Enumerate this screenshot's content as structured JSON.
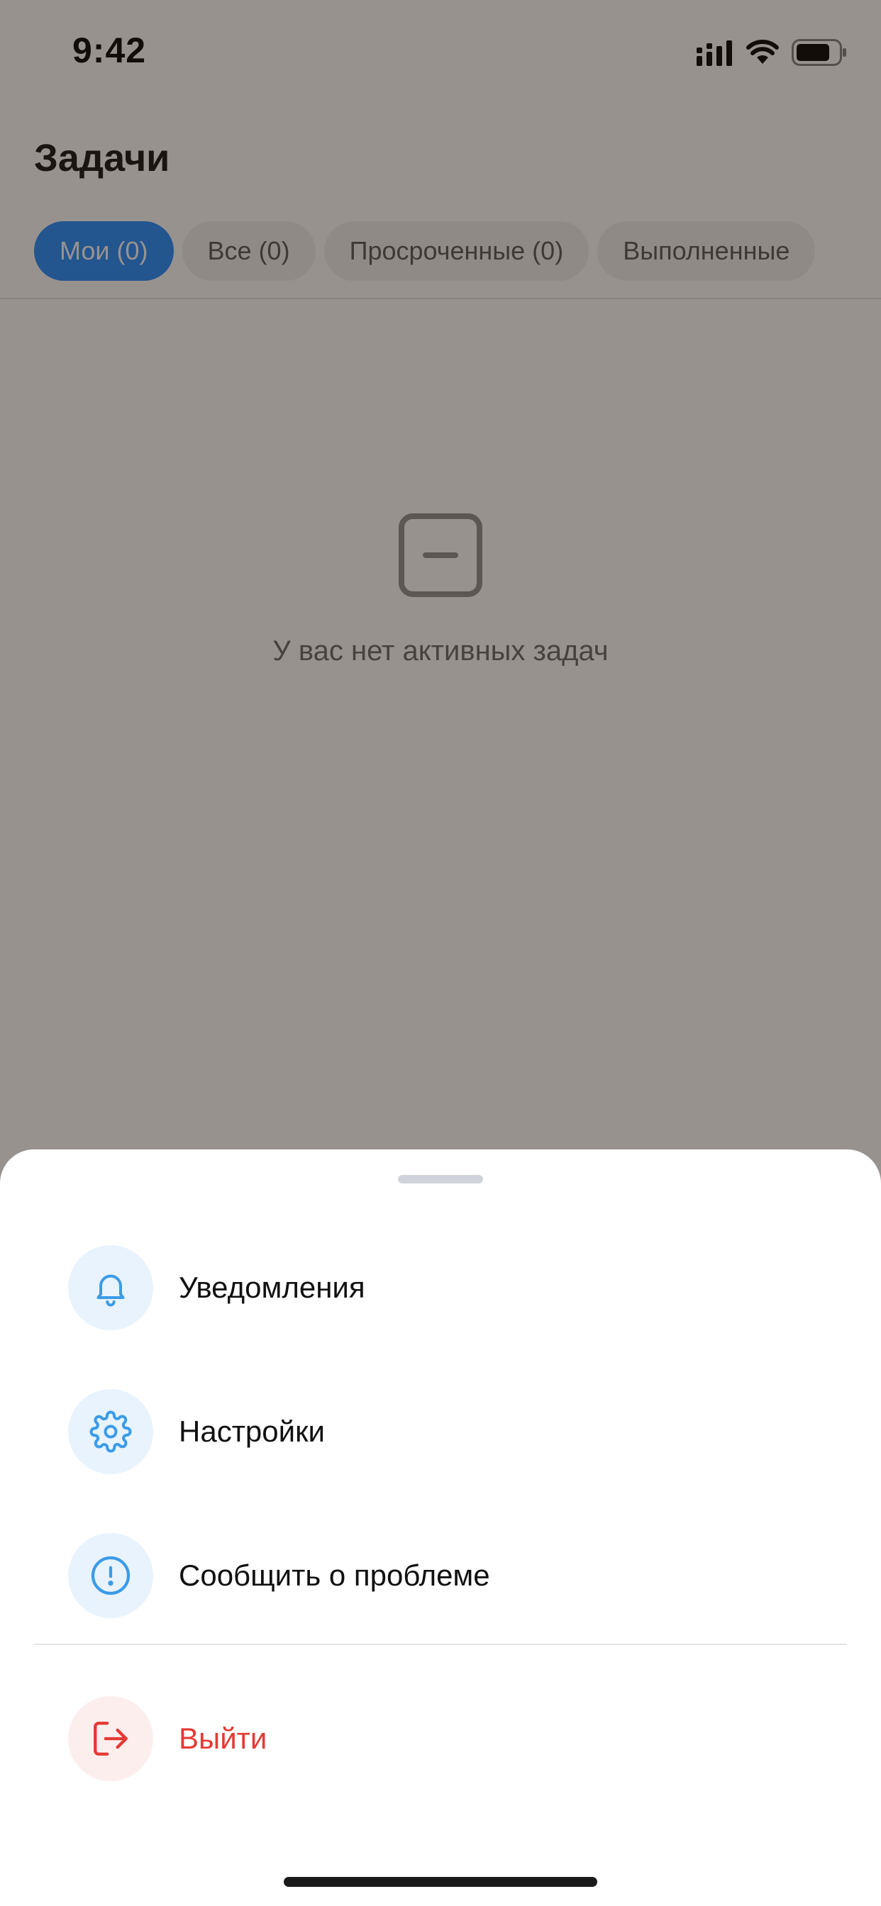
{
  "status_bar": {
    "time": "9:42",
    "icons": [
      "cellular-signal-icon",
      "wifi-icon",
      "battery-icon"
    ]
  },
  "header": {
    "title": "Задачи",
    "tabs": [
      {
        "label": "Мои (0)",
        "active": true
      },
      {
        "label": "Все (0)",
        "active": false
      },
      {
        "label": "Просроченные (0)",
        "active": false
      },
      {
        "label": "Выполненные",
        "active": false
      }
    ]
  },
  "empty_state": {
    "icon": "empty-box-icon",
    "text": "У вас нет активных задач"
  },
  "sheet": {
    "items": [
      {
        "label": "Уведомления",
        "icon": "bell-icon"
      },
      {
        "label": "Настройки",
        "icon": "gear-icon"
      },
      {
        "label": "Сообщить о проблеме",
        "icon": "alert-circle-icon"
      }
    ],
    "logout": {
      "label": "Выйти",
      "icon": "logout-icon"
    }
  },
  "colors": {
    "accent": "#1f8bff",
    "icon_blue": "#3b9be8",
    "danger": "#e53935",
    "overlay": "rgba(40,28,20,0.48)"
  }
}
